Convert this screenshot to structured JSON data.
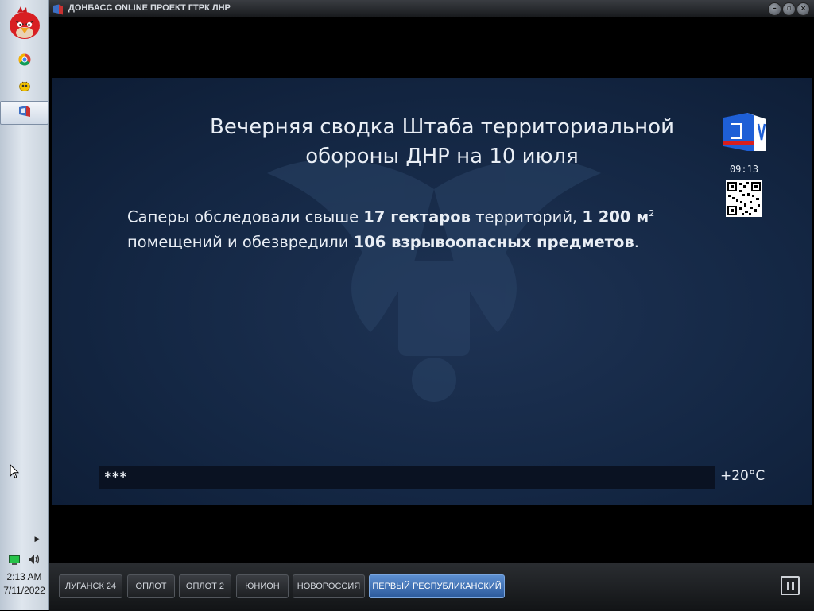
{
  "window": {
    "title": "ДОНБАСС ONLINE ПРОЕКТ ГТРК ЛНР",
    "controls": [
      "minimize-icon",
      "maximize-icon",
      "close-icon"
    ]
  },
  "taskbar": {
    "start_icon": "angry-bird-icon",
    "items": [
      {
        "icon": "chrome-icon"
      },
      {
        "icon": "pidgin-icon"
      },
      {
        "icon": "tv-player-icon",
        "active": true
      }
    ],
    "tray": {
      "network_icon": "network-icon",
      "volume_icon": "speaker-icon"
    },
    "clock": {
      "time": "2:13 AM",
      "date": "7/11/2022"
    }
  },
  "video": {
    "headline_line1": "Вечерняя сводка Штаба территориальной",
    "headline_line2": "обороны ДНР на 10 июля",
    "body": {
      "p1": "Саперы обследовали свыше ",
      "b1": "17 гектаров",
      "p2": " территорий, ",
      "b2": "1 200 м",
      "sup": "2",
      "p3": "помещений и обезвредили ",
      "b3": "106 взрывоопасных предметов",
      "p4": "."
    },
    "channel_logo": "channel-logo-icon",
    "clock": "09:13",
    "ticker": "***",
    "temperature": "+20°C",
    "colors": {
      "background": "#142744",
      "text": "#e9eef5",
      "logo_blue": "#1e5fd6",
      "logo_red": "#d81e1e"
    }
  },
  "channels": [
    {
      "label": "ЛУГАНСК 24"
    },
    {
      "label": "ОПЛОТ"
    },
    {
      "label": "ОПЛОТ 2"
    },
    {
      "label": "ЮНИОН"
    },
    {
      "label": "НОВОРОССИЯ"
    },
    {
      "label": "ПЕРВЫЙ РЕСПУБЛИКАНСКИЙ",
      "active": true
    }
  ],
  "player": {
    "pause_icon": "pause-icon"
  }
}
